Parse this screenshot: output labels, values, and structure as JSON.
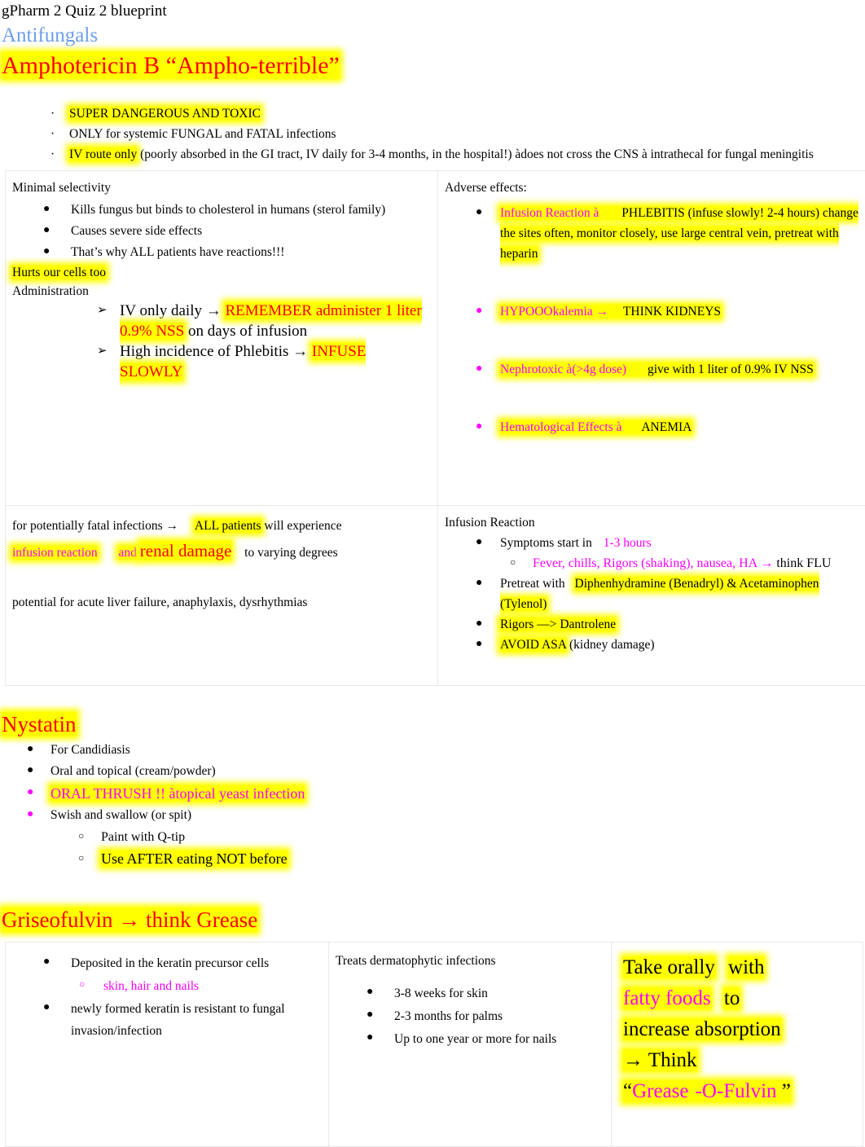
{
  "doc": {
    "title": "gPharm 2 Quiz 2 blueprint",
    "section_heading": "Antifungals"
  },
  "ampho": {
    "heading": "Amphotericin B “Ampho-terrible”",
    "bullet_glyph": "·",
    "points": [
      {
        "text": "SUPER DANGEROUS AND TOXIC",
        "highlight": true
      },
      {
        "text": "ONLY for systemic FUNGAL and FATAL infections",
        "highlight": false
      },
      {
        "lead": "IV route only",
        "rest": "(poorly absorbed in the GI tract, IV daily for 3-4 months, in the hospital!) àdoes not cross the CNS à intrathecal for fungal meningitis"
      }
    ]
  },
  "selectivity": {
    "title": "Minimal selectivity",
    "bullet_glyph": "●",
    "items": [
      "Kills fungus but binds to cholesterol in humans (sterol family)",
      "Causes severe side effects",
      "That’s why ALL patients have reactions!!!"
    ],
    "note": "Hurts our cells too",
    "admin_title": "Administration",
    "arrow_glyph": "➢",
    "admin_items": [
      {
        "a": "IV only daily",
        "arrow": "→",
        "b": "REMEMBER administer 1 liter 0.9% NSS",
        "c": "on days of infusion"
      },
      {
        "a": "High incidence of Phlebitis",
        "arrow": "→",
        "b": "INFUSE SLOWLY",
        "c": ""
      }
    ]
  },
  "adverse": {
    "title": "Adverse effects:",
    "bullet_glyph": "●",
    "items": [
      {
        "lead": "Infusion Reaction à",
        "rest": "PHLEBITIS (infuse slowly! 2-4 hours) change the sites often, monitor closely, use large central vein, pretreat with heparin",
        "bullet_color": "#000000"
      },
      {
        "lead": "HYPOOOkalemia →",
        "rest": "THINK KIDNEYS",
        "bullet_color": "#ff00ff"
      },
      {
        "lead": "Nephrotoxic à(>4g dose)",
        "rest": "give with 1 liter of 0.9% IV NSS",
        "bullet_color": "#ff00ff"
      },
      {
        "lead": "Hematological Effects à",
        "rest": "ANEMIA",
        "bullet_color": "#ff00ff"
      }
    ]
  },
  "fatal": {
    "line1_a": "for potentially fatal infections →",
    "line1_b": "ALL patients",
    "line1_c": "will experience",
    "line2_a": "infusion reaction",
    "line2_b": "and",
    "line2_c": "renal damage",
    "line2_d": "to varying degrees",
    "line3": "potential for acute liver failure, anaphylaxis, dysrhythmias"
  },
  "infusion_reaction": {
    "title": "Infusion Reaction",
    "bullet_glyph": "●",
    "sub_bullet_glyph": "○",
    "items": [
      {
        "lead": "Symptoms start in",
        "accent": "1-3 hours",
        "level": 1
      },
      {
        "accent": "Fever, chills, Rigors (shaking), nausea, HA →",
        "tail": "think FLU",
        "level": 2
      },
      {
        "lead": "Pretreat with",
        "hl": "Diphenhydramine (Benadryl) & Acetaminophen (Tylenol)",
        "level": 1
      },
      {
        "hl": "Rigors —> Dantrolene",
        "level": 1
      },
      {
        "hl": "AVOID ASA",
        "tail": "(kidney damage)",
        "level": 1
      }
    ]
  },
  "nystatin": {
    "heading": "Nystatin",
    "bullet_glyph": "●",
    "sub_bullet_glyph": "○",
    "items": [
      {
        "text": "For Candidiasis",
        "bullet_color": "#000000"
      },
      {
        "text": "Oral and topical (cream/powder)",
        "bullet_color": "#000000"
      },
      {
        "text": "ORAL THRUSH !! àtopical yeast infection",
        "bullet_color": "#ff00ff",
        "magenta": true,
        "highlight": true,
        "big": true
      },
      {
        "text": "Swish and swallow (or spit)",
        "bullet_color": "#ff00ff"
      }
    ],
    "subitems": [
      {
        "text": "Paint with Q-tip",
        "highlight": false
      },
      {
        "text": "Use AFTER eating NOT before",
        "highlight": true,
        "big": true
      }
    ]
  },
  "griseofulvin": {
    "heading": "Griseofulvin → think Grease",
    "bullet_glyph": "●",
    "sub_bullet_glyph": "○",
    "box1": {
      "items": [
        "Deposited in the keratin precursor cells",
        "newly formed keratin is resistant to fungal invasion/infection"
      ],
      "subitem": "skin, hair and nails"
    },
    "box2": {
      "title": "Treats dermatophytic infections",
      "items": [
        "3-8 weeks for skin",
        "2-3 months for palms",
        "Up to one year or more for nails"
      ]
    },
    "box3": {
      "p1": "Take orally",
      "p2": "with",
      "p3": "fatty foods",
      "p4": "to",
      "p5": "increase absorption",
      "p6": "→ Think",
      "p7_open": "“",
      "p7_a": "Grease",
      "p7_b": "-O-Fulvin",
      "p7_close": "”"
    }
  }
}
